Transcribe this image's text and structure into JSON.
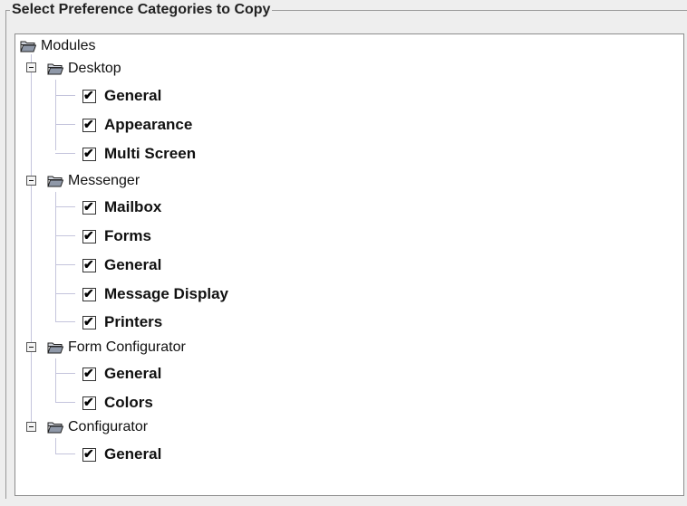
{
  "group_title": "Select Preference Categories to Copy",
  "icons": {
    "folder": "folder-open-icon",
    "expander": "collapse-minus-icon",
    "check": "✔"
  },
  "tree": {
    "root_label": "Modules",
    "categories": [
      {
        "label": "Desktop",
        "expanded": true,
        "items": [
          {
            "label": "General",
            "checked": true
          },
          {
            "label": "Appearance",
            "checked": true
          },
          {
            "label": "Multi Screen",
            "checked": true
          }
        ]
      },
      {
        "label": "Messenger",
        "expanded": true,
        "items": [
          {
            "label": "Mailbox",
            "checked": true
          },
          {
            "label": "Forms",
            "checked": true
          },
          {
            "label": "General",
            "checked": true
          },
          {
            "label": "Message Display",
            "checked": true
          },
          {
            "label": "Printers",
            "checked": true
          }
        ]
      },
      {
        "label": "Form Configurator",
        "expanded": true,
        "items": [
          {
            "label": "General",
            "checked": true
          },
          {
            "label": "Colors",
            "checked": true
          }
        ]
      },
      {
        "label": "Configurator",
        "expanded": true,
        "items": [
          {
            "label": "General",
            "checked": true
          }
        ]
      }
    ]
  }
}
